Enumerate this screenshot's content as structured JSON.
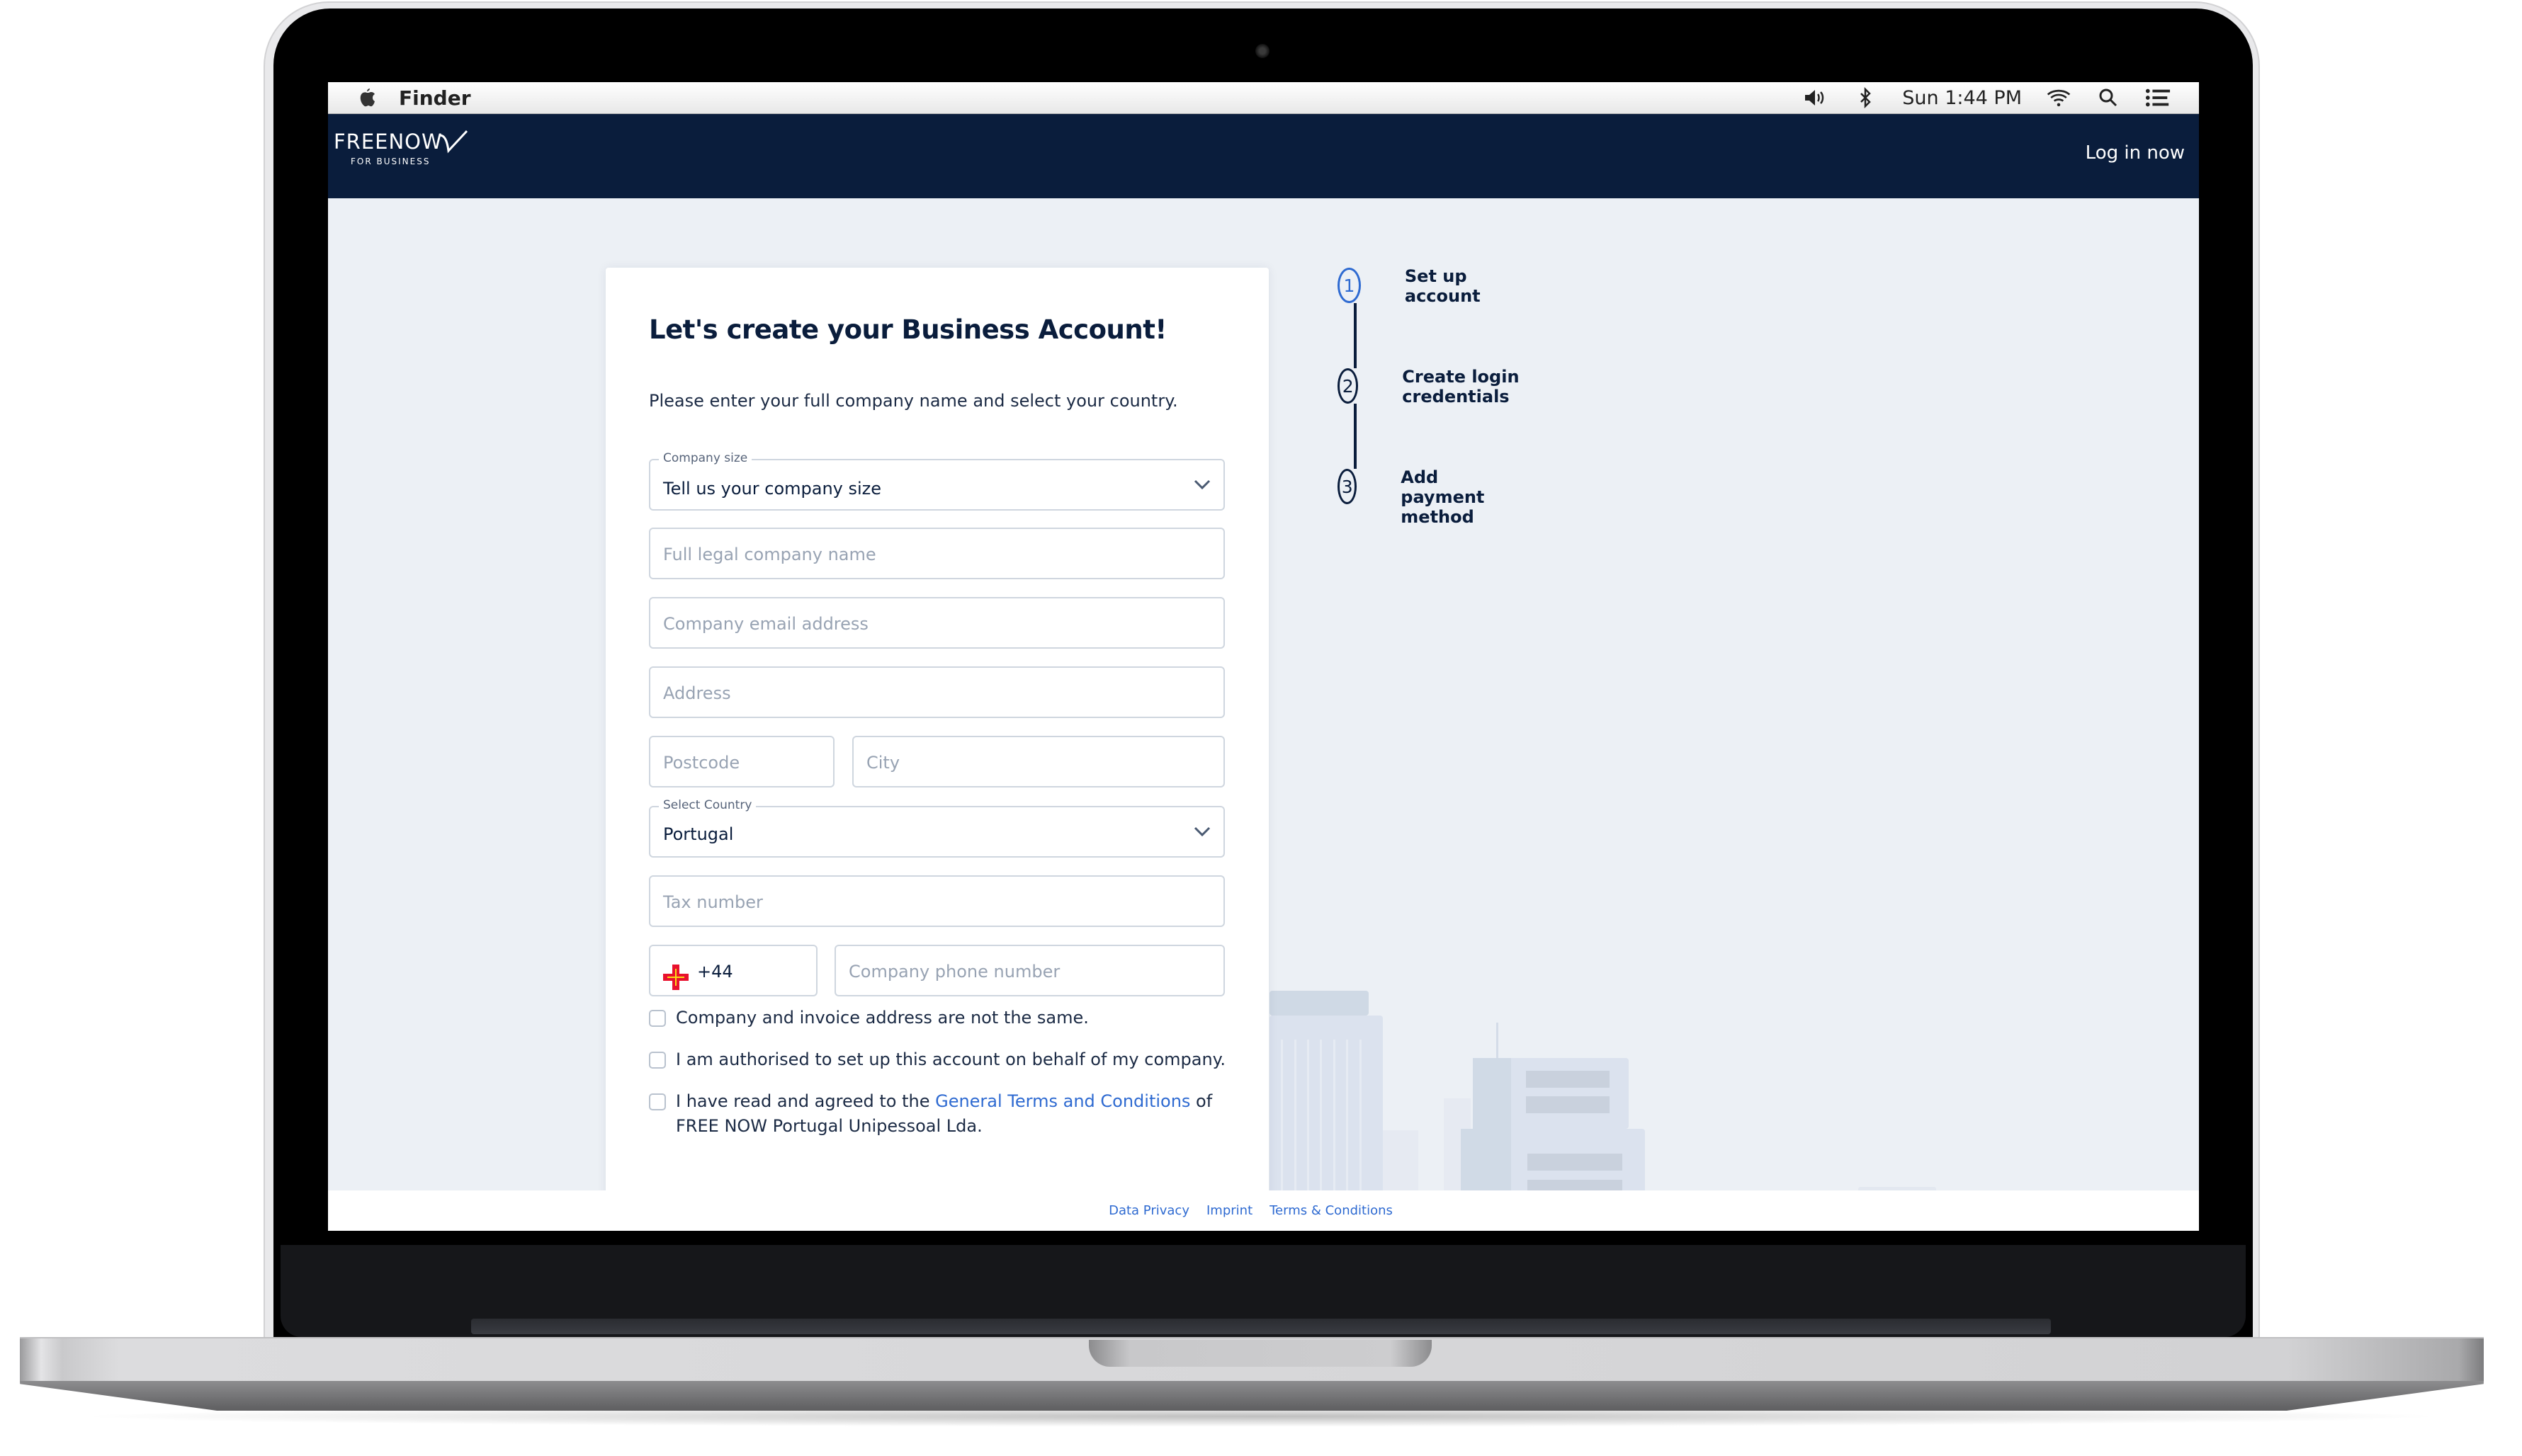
{
  "menubar": {
    "app_name": "Finder",
    "clock": "Sun 1:44 PM",
    "icons": [
      "apple-icon",
      "volume-icon",
      "bluetooth-icon",
      "wifi-icon",
      "spotlight-search-icon",
      "notification-list-icon"
    ]
  },
  "header": {
    "logo_word": "FREENOW",
    "logo_sub": "FOR BUSINESS",
    "login_label": "Log in now",
    "bg_color": "#0a1d3c"
  },
  "form": {
    "title": "Let's create your Business Account!",
    "intro": "Please enter your full company name and select your country.",
    "company_size": {
      "legend": "Company size",
      "value": "Tell us your company size"
    },
    "company_name_placeholder": "Full legal company name",
    "email_placeholder": "Company email address",
    "address_placeholder": "Address",
    "postcode_placeholder": "Postcode",
    "city_placeholder": "City",
    "country": {
      "legend": "Select Country",
      "value": "Portugal"
    },
    "tax_placeholder": "Tax number",
    "phone": {
      "flag": "guernsey-flag-icon",
      "code": "+44",
      "placeholder": "Company phone number"
    },
    "checkboxes": [
      {
        "label": "Company and invoice address are not the same.",
        "checked": false
      },
      {
        "label": "I am authorised to set up this account on behalf of my company.",
        "checked": false
      },
      {
        "label_before": "I have read and agreed to the ",
        "link": "General Terms and Conditions",
        "label_after": " of FREE NOW Portugal Unipessoal Lda.",
        "checked": false
      }
    ]
  },
  "stepper": {
    "steps": [
      {
        "number": "1",
        "label": "Set up account",
        "active": true
      },
      {
        "number": "2",
        "label": "Create login credentials",
        "active": false
      },
      {
        "number": "3",
        "label": "Add payment method",
        "active": false
      }
    ]
  },
  "footer": {
    "links": [
      "Data Privacy",
      "Imprint",
      "Terms & Conditions"
    ]
  },
  "colors": {
    "accent": "#2e6ad1",
    "navy": "#0a1d3c",
    "background": "#ecf0f5"
  }
}
